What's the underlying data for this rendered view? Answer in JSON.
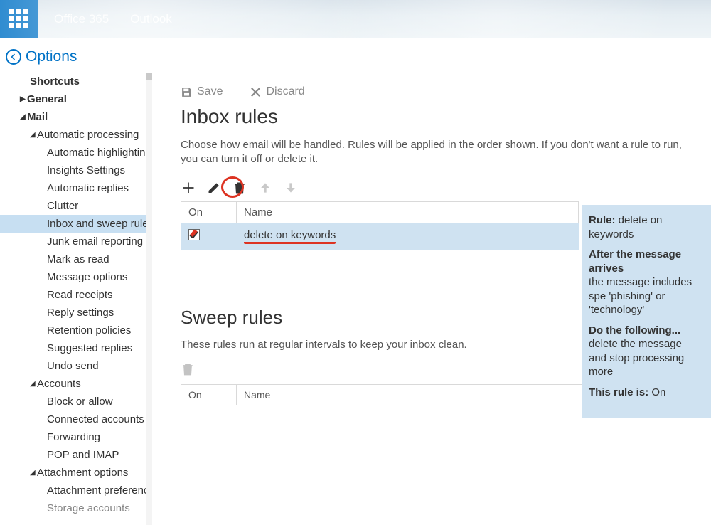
{
  "header": {
    "brand1": "Office 365",
    "brand2": "Outlook"
  },
  "options_title": "Options",
  "sidebar": {
    "shortcuts": "Shortcuts",
    "general": "General",
    "mail": "Mail",
    "auto_processing": "Automatic processing",
    "auto_items": [
      "Automatic highlighting",
      "Insights Settings",
      "Automatic replies",
      "Clutter",
      "Inbox and sweep rules",
      "Junk email reporting",
      "Mark as read",
      "Message options",
      "Read receipts",
      "Reply settings",
      "Retention policies",
      "Suggested replies",
      "Undo send"
    ],
    "accounts": "Accounts",
    "account_items": [
      "Block or allow",
      "Connected accounts",
      "Forwarding",
      "POP and IMAP"
    ],
    "attachment": "Attachment options",
    "attachment_items": [
      "Attachment preference",
      "Storage accounts"
    ]
  },
  "actions": {
    "save": "Save",
    "discard": "Discard"
  },
  "inbox": {
    "title": "Inbox rules",
    "desc": "Choose how email will be handled. Rules will be applied in the order shown. If you don't want a rule to run, you can turn it off or delete it.",
    "col_on": "On",
    "col_name": "Name",
    "rule_name": "delete on keywords"
  },
  "detail": {
    "rule_label": "Rule:",
    "rule_name": "delete on keywords",
    "arrives_label": "After the message arrives",
    "arrives_body": "the message includes spe 'phishing' or 'technology'",
    "do_label": "Do the following...",
    "do_body1": "delete the message",
    "do_body2": "and stop processing more",
    "status_label": "This rule is:",
    "status_value": "On"
  },
  "sweep": {
    "title": "Sweep rules",
    "desc": "These rules run at regular intervals to keep your inbox clean.",
    "col_on": "On",
    "col_name": "Name"
  }
}
